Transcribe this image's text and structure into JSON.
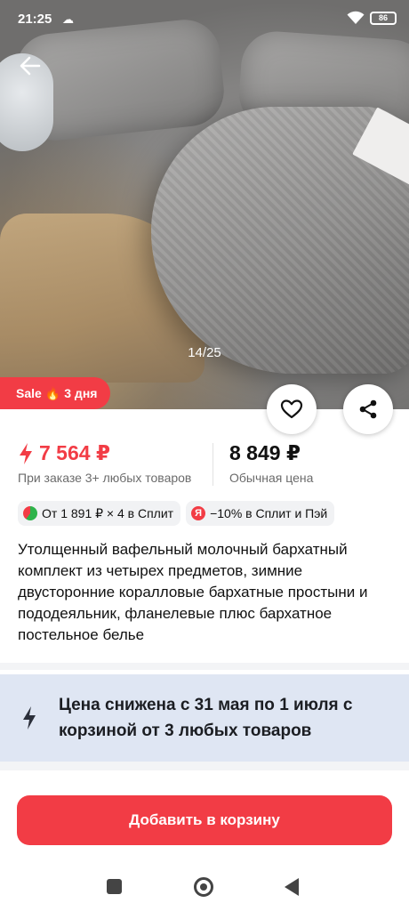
{
  "status": {
    "time": "21:25",
    "battery": "86"
  },
  "gallery": {
    "counter": "14/25"
  },
  "sale": {
    "label": "Sale",
    "emoji": "🔥",
    "days": "3 дня"
  },
  "price": {
    "promo": "7 564 ₽",
    "promo_note": "При заказе 3+ любых товаров",
    "regular": "8 849 ₽",
    "regular_note": "Обычная цена"
  },
  "chips": {
    "split": "От 1 891 ₽ × 4 в Сплит",
    "yandex_letter": "Я",
    "pay": "−10% в Сплит и Пэй"
  },
  "product": {
    "title": "Утолщенный вафельный молочный бархатный комплект из четырех предметов, зимние двусторонние коралловые бархатные простыни и пододеяльник, фланелевые плюс бархатное постельное белье"
  },
  "promo_banner": {
    "text": "Цена снижена с 31 мая по 1 июля с корзиной от 3 любых товаров"
  },
  "cta": {
    "label": "Добавить в корзину"
  },
  "colors": {
    "accent": "#f23c45",
    "promo_bg": "#dfe6f3"
  }
}
